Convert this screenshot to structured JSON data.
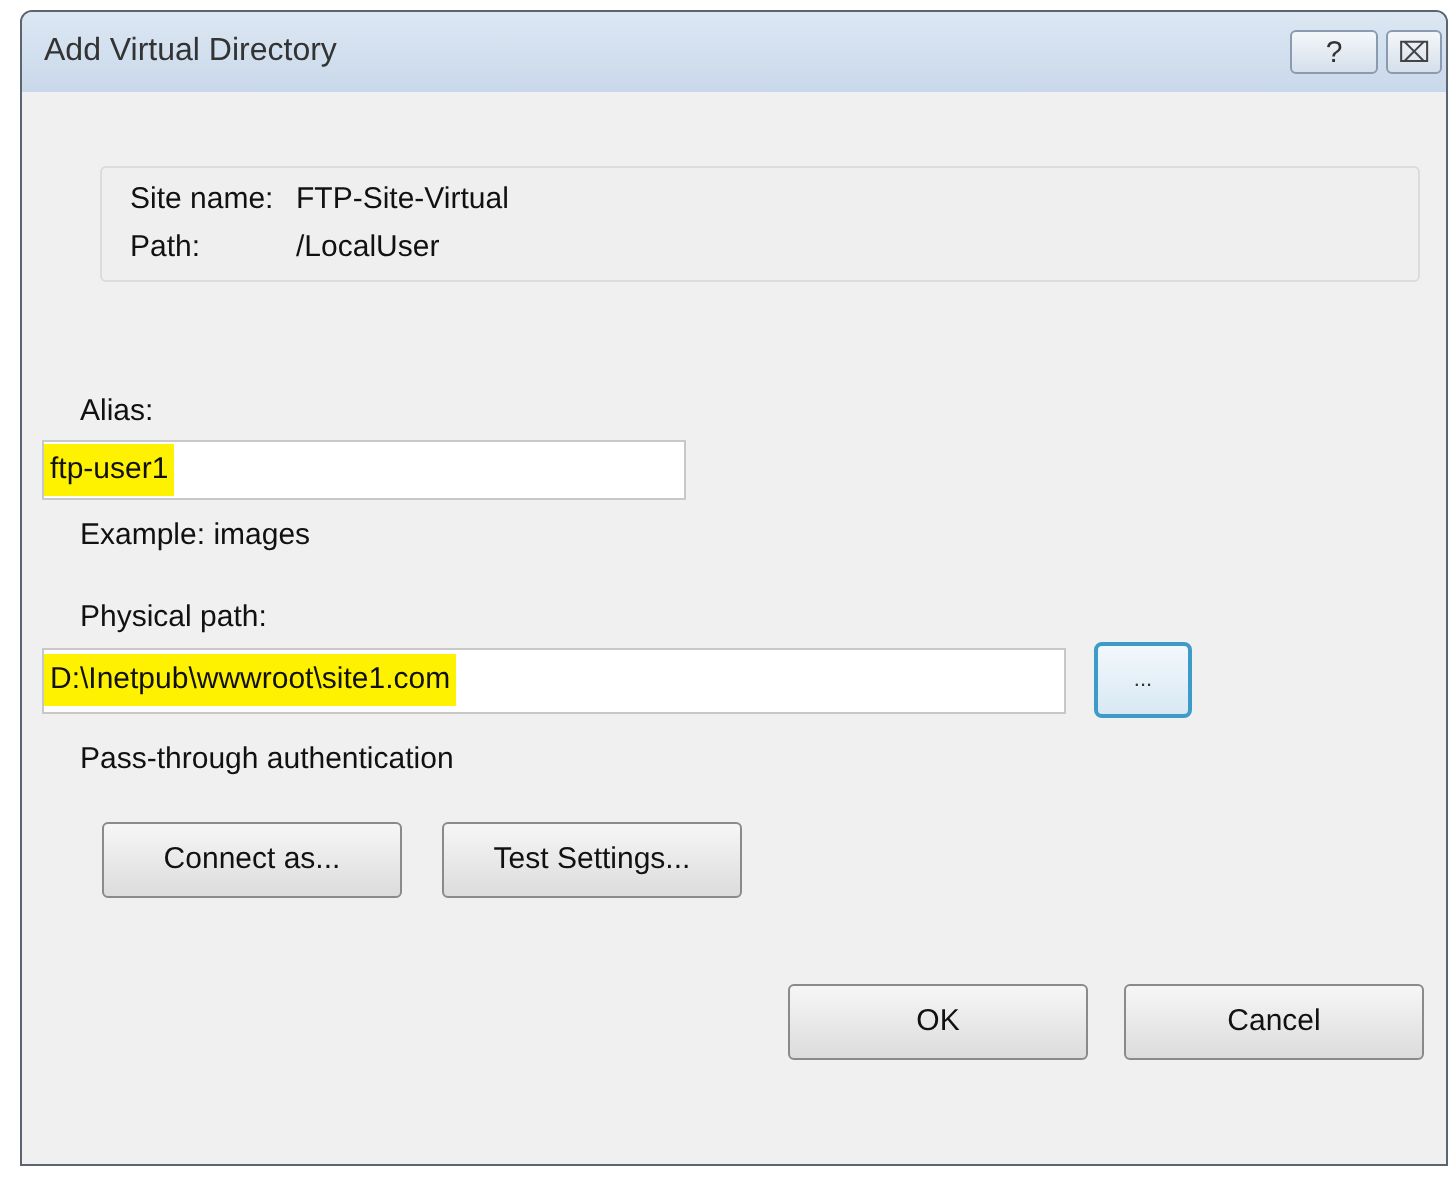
{
  "window": {
    "title": "Add Virtual Directory",
    "title_buttons": [
      "?",
      "⌧"
    ]
  },
  "info": [
    {
      "label": "Site name:",
      "value": "FTP-Site-Virtual"
    },
    {
      "label": "Path:",
      "value": "/LocalUser"
    }
  ],
  "alias": {
    "label": "Alias:",
    "value": "ftp-user1",
    "highlighted": true,
    "hint": "Example: images"
  },
  "physical_path": {
    "label": "Physical path:",
    "value": "D:\\Inetpub\\wwwroot\\site1.com",
    "highlighted": true,
    "browse_button": "...",
    "focused": true
  },
  "auth_label": "Pass-through authentication",
  "actions": [
    "Connect as...",
    "Test Settings..."
  ],
  "buttons": [
    "OK",
    "Cancel"
  ]
}
